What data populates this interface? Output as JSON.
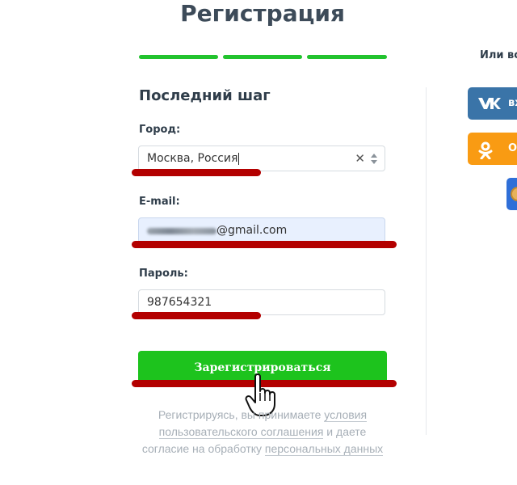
{
  "page": {
    "title": "Регистрация"
  },
  "progress": {
    "steps_total": 3,
    "steps_completed": 3,
    "color": "#22c32e"
  },
  "form": {
    "step_title": "Последний шаг",
    "city": {
      "label": "Город:",
      "value": "Москва, Россия"
    },
    "email": {
      "label": "E-mail:",
      "value": "@gmail.com"
    },
    "password": {
      "label": "Пароль:",
      "value": "987654321"
    },
    "submit_label": "Зарегистрироваться",
    "legal": {
      "text_1": "Регистрируясь, вы принимаете ",
      "link_terms": "условия пользовательского соглашения",
      "text_2": " и даете согласие на обработку ",
      "link_privacy": "персональных данных"
    }
  },
  "social": {
    "heading": "Или во",
    "vk_label": "вх",
    "ok_label": "Од"
  },
  "colors": {
    "accent_green": "#1dc31d",
    "annotation_red": "#b30000",
    "vk_blue": "#3a74a8",
    "ok_orange": "#f99b13"
  },
  "icons": [
    "clear-icon",
    "select-arrows-icon",
    "vk-icon",
    "odnoklassniki-icon",
    "hand-cursor-icon"
  ]
}
